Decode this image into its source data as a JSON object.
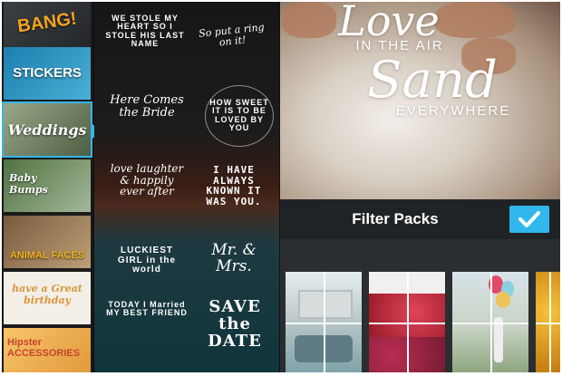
{
  "categories": [
    {
      "label": "BANG!",
      "bg": "#2b2f33",
      "color": "#f7a41d"
    },
    {
      "label": "STICKERS",
      "bg": "#2a8ab0",
      "color": "#ffffff"
    },
    {
      "label": "Weddings",
      "bg": "#6c7a5c",
      "color": "#ffffff"
    },
    {
      "label": "Baby Bumps",
      "bg": "#6f8b60",
      "color": "#ffffff"
    },
    {
      "label": "ANIMAL FACES",
      "bg": "#8a6a4b",
      "color": "#f3b21c"
    },
    {
      "label": "have a Great birthday",
      "bg": "#f3efe6",
      "color": "#d9953a"
    },
    {
      "label": "Hipster ACCESSORIES",
      "bg": "#f0b95c",
      "color": "#c8442f"
    }
  ],
  "overlays": [
    "WE STOLE MY HEART SO I STOLE HIS LAST NAME",
    "So put a ring on it!",
    "Here Comes the Bride",
    "HOW SWEET IT IS TO BE LOVED BY YOU",
    "love laughter & happily ever after",
    "I HAVE ALWAYS KNOWN IT WAS YOU.",
    "LUCKIEST GIRL in the world",
    "Mr. & Mrs.",
    "TODAY I Married MY BEST FRIEND",
    "SAVE the DATE"
  ],
  "photo": {
    "line1": "Love",
    "line2": "IN THE AIR",
    "line3": "Sand",
    "line4": "EVERYWHERE"
  },
  "filter_bar": {
    "title": "Filter Packs",
    "accent": "#31b7ec"
  },
  "thumbnails": [
    {
      "name": "laptop",
      "bg": "#cfd8d8"
    },
    {
      "name": "raspberries",
      "bg": "#c6303f"
    },
    {
      "name": "balloons",
      "bg": "#9fb8a0"
    },
    {
      "name": "sunflower",
      "bg": "#e3a11c"
    }
  ]
}
